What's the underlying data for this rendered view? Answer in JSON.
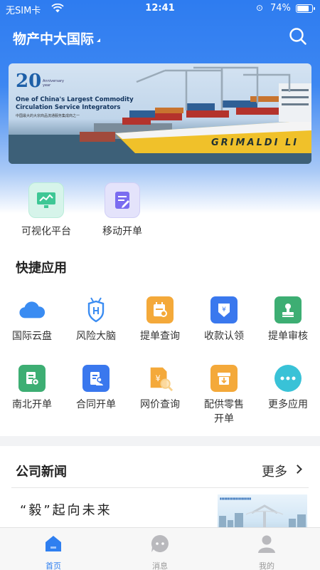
{
  "status": {
    "carrier": "无SIM卡",
    "time": "12:41",
    "battery": "74%",
    "battery_level": 0.74
  },
  "header": {
    "title": "物产中大国际"
  },
  "banner": {
    "badge_number": "20",
    "anniversary_text": "Anniversary year",
    "headline_line1": "One of China's Largest Commodity",
    "headline_line2": "Circulation Service Integrators",
    "headline_cn": "中国最大的大宗商品流通服务集成商之一",
    "ship_name": "GRIMALDI LI"
  },
  "features": [
    {
      "label": "可视化平台",
      "icon": "monitor-chart-icon"
    },
    {
      "label": "移动开单",
      "icon": "edit-document-icon"
    }
  ],
  "quick_apps": {
    "title": "快捷应用",
    "items": [
      {
        "label": "国际云盘",
        "icon": "cloud-icon"
      },
      {
        "label": "风险大脑",
        "icon": "shield-brain-icon"
      },
      {
        "label": "提单查询",
        "icon": "bill-search-icon"
      },
      {
        "label": "收款认领",
        "icon": "yuan-download-icon"
      },
      {
        "label": "提单审核",
        "icon": "stamp-icon"
      },
      {
        "label": "南北开单",
        "icon": "document-gear-icon"
      },
      {
        "label": "合同开单",
        "icon": "contract-icon"
      },
      {
        "label": "网价查询",
        "icon": "price-search-icon"
      },
      {
        "label": "配供零售\n开单",
        "icon": "box-download-icon"
      },
      {
        "label": "更多应用",
        "icon": "more-icon"
      }
    ]
  },
  "news": {
    "title": "公司新闻",
    "more": "更多",
    "items": [
      {
        "title": "“毅”起向未来"
      }
    ]
  },
  "tabbar": [
    {
      "label": "首页",
      "icon": "home-icon",
      "active": true
    },
    {
      "label": "消息",
      "icon": "message-icon",
      "active": false
    },
    {
      "label": "我的",
      "icon": "profile-icon",
      "active": false
    }
  ],
  "colors": {
    "primary": "#2f7ff0",
    "header_top": "#2e7cf0"
  }
}
